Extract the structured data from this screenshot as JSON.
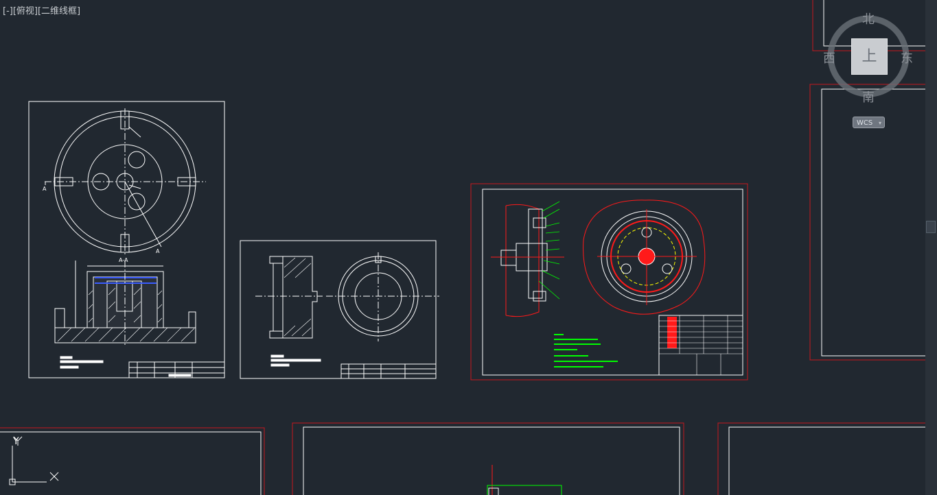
{
  "viewport": {
    "label": "[-][俯视][二维线框]"
  },
  "viewcube": {
    "north": "北",
    "south": "南",
    "east": "东",
    "west": "西",
    "top_face": "上",
    "wcs_label": "WCS",
    "wcs_arrow": "▾"
  },
  "ucs": {
    "y_label": "Y",
    "x_label": "X"
  },
  "drawing1": {
    "section_label": "A-A",
    "marker_a": "A"
  },
  "colors": {
    "background": "#212830",
    "layout_border": "#c8191e",
    "line_white": "#ffffff",
    "line_green": "#00ff00",
    "line_red": "#ff1a1a",
    "line_yellow": "#ffff00",
    "line_blue": "#3a5bff"
  }
}
